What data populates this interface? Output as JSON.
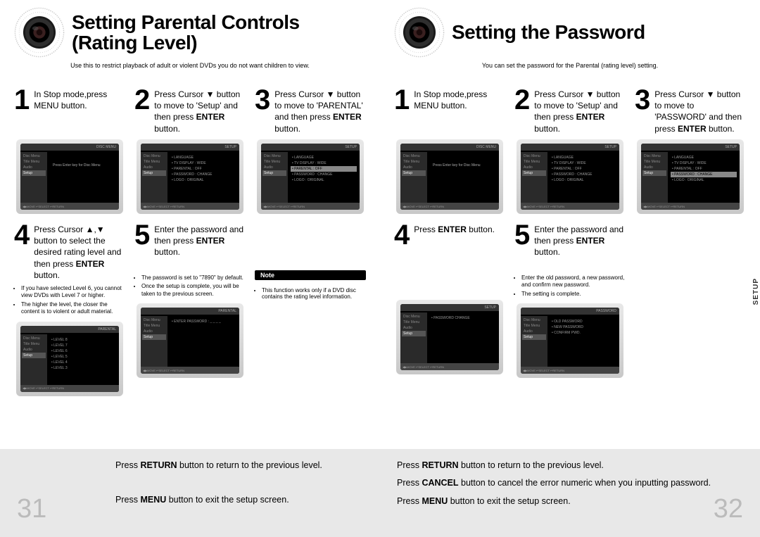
{
  "left": {
    "title": "Setting Parental Controls (Rating Level)",
    "subtitle": "Use this to restrict playback of adult or violent DVDs you do not want children to view.",
    "steps": {
      "s1": {
        "num": "1",
        "text": "In Stop mode,press MENU button."
      },
      "s2": {
        "num": "2",
        "pre": "Press Cursor ▼ button to move to 'Setup' and then press ",
        "bold": "ENTER",
        "post": " button."
      },
      "s3": {
        "num": "3",
        "pre": "Press Cursor ▼ button to move to 'PARENTAL' and then press ",
        "bold": "ENTER",
        "post": " button."
      },
      "s4": {
        "num": "4",
        "pre": "Press Cursor ▲,▼ button to select the desired rating level and then press ",
        "bold": "ENTER",
        "post": " button."
      },
      "s5": {
        "num": "5",
        "pre": "Enter the password and then press ",
        "bold": "ENTER",
        "post": " button."
      }
    },
    "bullets4": [
      "If you have selected Level 6, you cannot view DVDs with Level 7 or higher.",
      "The higher the level, the closer the content is to violent or adult material."
    ],
    "bullets5": [
      "The password is set to \"7890\" by default.",
      "Once the setup is complete, you will be taken to the previous screen."
    ],
    "noteLabel": "Note",
    "noteBullets": [
      "This function works only if a DVD disc contains the rating level information."
    ],
    "footer": {
      "return": "Press RETURN button to return to the previous level.",
      "menu": "Press MENU button to exit the setup screen.",
      "page": "31"
    },
    "screens": {
      "menu": {
        "top": "DISC MENU",
        "side": [
          "Disc Menu",
          "Title Menu",
          "Audio",
          "Setup"
        ],
        "mainText": "Press Enter key for Disc Menu"
      },
      "setup": {
        "top": "SETUP",
        "side": [
          "Disc Menu",
          "Title Menu",
          "Audio",
          "Setup"
        ],
        "items": [
          "LANGUAGE",
          "TV DISPLAY : WIDE",
          "PARENTAL : OFF",
          "PASSWORD : CHANGE",
          "LOGO : ORIGINAL"
        ]
      },
      "parental": {
        "top": "SETUP",
        "side": [
          "Disc Menu",
          "Title Menu",
          "Audio",
          "Setup"
        ],
        "items": [
          "LANGUAGE",
          "TV DISPLAY : WIDE",
          "PARENTAL : OFF",
          "PASSWORD : CHANGE",
          "LOGO : ORIGINAL"
        ],
        "sel": 2
      },
      "levels": {
        "top": "PARENTAL",
        "side": [
          "Disc Menu",
          "Title Menu",
          "Audio",
          "Setup"
        ],
        "items": [
          "LEVEL 8",
          "LEVEL 7",
          "LEVEL 6",
          "LEVEL 5",
          "LEVEL 4",
          "LEVEL 3"
        ]
      },
      "pass": {
        "top": "PARENTAL",
        "side": [
          "Disc Menu",
          "Title Menu",
          "Audio",
          "Setup"
        ],
        "items": [
          "ENTER PASSWORD : _ _ _ _"
        ]
      }
    }
  },
  "right": {
    "title": "Setting the Password",
    "subtitle": "You can set the password for the Parental (rating level) setting.",
    "steps": {
      "s1": {
        "num": "1",
        "text": "In Stop mode,press MENU button."
      },
      "s2": {
        "num": "2",
        "pre": "Press Cursor ▼ button to move to 'Setup' and then press ",
        "bold": "ENTER",
        "post": " button."
      },
      "s3": {
        "num": "3",
        "pre": "Press Cursor ▼ button to move to 'PASSWORD' and then press ",
        "bold": "ENTER",
        "post": " button."
      },
      "s4": {
        "num": "4",
        "pre": "Press ",
        "bold": "ENTER",
        "post": " button."
      },
      "s5": {
        "num": "5",
        "pre": "Enter the password and then press ",
        "bold": "ENTER",
        "post": " button."
      }
    },
    "bullets5": [
      "Enter the old password, a new password, and confirm new password.",
      "The setting is complete."
    ],
    "footer": {
      "return": "Press RETURN button to return to the previous level.",
      "cancel": "Press CANCEL button to cancel the error numeric when you inputting password.",
      "menu": "Press MENU button to exit the setup screen.",
      "page": "32"
    },
    "screens": {
      "menu": {
        "top": "DISC MENU",
        "side": [
          "Disc Menu",
          "Title Menu",
          "Audio",
          "Setup"
        ],
        "mainText": "Press Enter key for Disc Menu"
      },
      "setup": {
        "top": "SETUP",
        "side": [
          "Disc Menu",
          "Title Menu",
          "Audio",
          "Setup"
        ],
        "items": [
          "LANGUAGE",
          "TV DISPLAY : WIDE",
          "PARENTAL : OFF",
          "PASSWORD : CHANGE",
          "LOGO : ORIGINAL"
        ]
      },
      "password": {
        "top": "SETUP",
        "side": [
          "Disc Menu",
          "Title Menu",
          "Audio",
          "Setup"
        ],
        "items": [
          "LANGUAGE",
          "TV DISPLAY : WIDE",
          "PARENTAL : OFF",
          "PASSWORD : CHANGE",
          "LOGO : ORIGINAL"
        ],
        "sel": 3
      },
      "change": {
        "top": "SETUP",
        "side": [
          "Disc Menu",
          "Title Menu",
          "Audio",
          "Setup"
        ],
        "items": [
          "PASSWORD   CHANGE"
        ]
      },
      "newpass": {
        "top": "PASSWORD",
        "side": [
          "Disc Menu",
          "Title Menu",
          "Audio",
          "Setup"
        ],
        "items": [
          "OLD PASSWORD",
          "NEW PASSWORD",
          "CONFIRM PWD."
        ]
      }
    }
  },
  "sideTab": "SETUP",
  "scrBottom": "◀▶MOVE  ↵SELECT  ↩RETURN"
}
